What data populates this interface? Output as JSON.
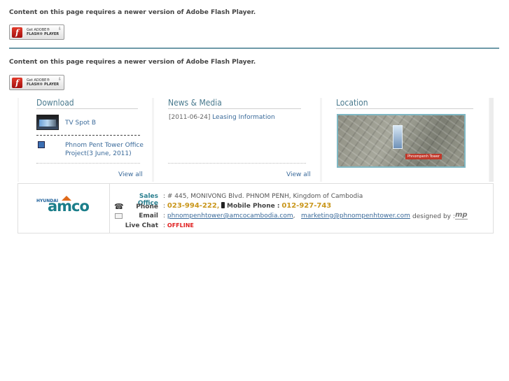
{
  "flash": {
    "message": "Content on this page requires a newer version of Adobe Flash Player.",
    "button_line1": "Get ADOBE®",
    "button_line2": "FLASH® PLAYER"
  },
  "download": {
    "title": "Download",
    "items": [
      {
        "label": "TV Spot B"
      },
      {
        "label": "Phnom Pent Tower Office Project(3 June, 2011)"
      }
    ],
    "view_all": "View all"
  },
  "news": {
    "title": "News & Media",
    "items": [
      {
        "date": "[2011-06-24]",
        "title": "Leasing Information"
      }
    ],
    "view_all": "View all"
  },
  "location": {
    "title": "Location",
    "map_caption": "Phnompenh Tower"
  },
  "footer": {
    "logo_small": "HYUNDAI",
    "logo_big": "amco",
    "sales_office_label": "Sales Office",
    "sales_office_value": "# 445, MONIVONG Blvd. PHNOM PENH, Kingdom of Cambodia",
    "phone_label": "Phone",
    "phone_value": "023-994-222",
    "mobile_label": "Mobile Phone :",
    "mobile_value": "012-927-743",
    "email_label": "Email",
    "email1": "phnompenhtower@amcocambodia.com",
    "email2": "marketing@phnompenhtower.com",
    "livechat_label": "Live Chat",
    "livechat_value": "OFFLINE",
    "designed_by": "designed by :",
    "designer_logo": "mp"
  },
  "colors": {
    "accent_teal": "#6e9aa8",
    "link_blue": "#3a6a9a",
    "phone_gold": "#c9961a",
    "offline_red": "#e02020",
    "amco_teal": "#1b7e8a",
    "label_teal": "#2a7f8f"
  }
}
